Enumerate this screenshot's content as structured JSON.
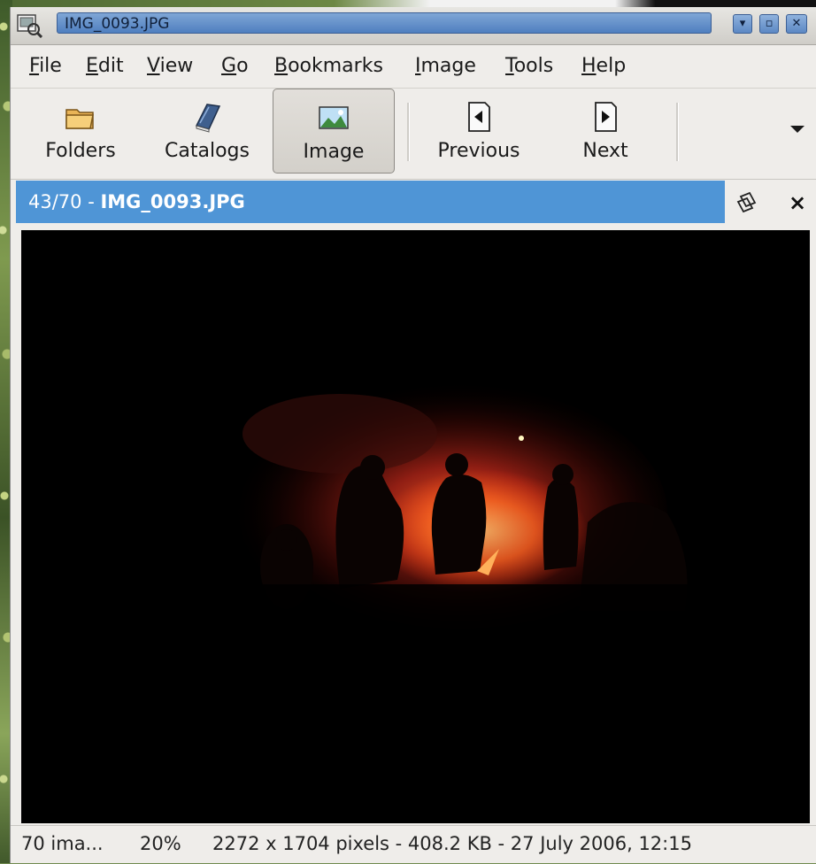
{
  "window": {
    "title": "IMG_0093.JPG",
    "controls": {
      "minimize_glyph": "▾",
      "maximize_glyph": "▫",
      "close_glyph": "✕"
    }
  },
  "menubar": {
    "items": [
      {
        "label": "File",
        "mnemonic": "F",
        "rest": "ile"
      },
      {
        "label": "Edit",
        "mnemonic": "E",
        "rest": "dit"
      },
      {
        "label": "View",
        "mnemonic": "V",
        "rest": "iew"
      },
      {
        "label": "Go",
        "mnemonic": "G",
        "rest": "o"
      },
      {
        "label": "Bookmarks",
        "mnemonic": "B",
        "rest": "ookmarks"
      },
      {
        "label": "Image",
        "mnemonic": "I",
        "rest": "mage"
      },
      {
        "label": "Tools",
        "mnemonic": "T",
        "rest": "ools"
      },
      {
        "label": "Help",
        "mnemonic": "H",
        "rest": "elp"
      }
    ]
  },
  "toolbar": {
    "folders_label": "Folders",
    "catalogs_label": "Catalogs",
    "image_label": "Image",
    "previous_label": "Previous",
    "next_label": "Next"
  },
  "image_header": {
    "position": "43/70 - ",
    "filename": "IMG_0093.JPG"
  },
  "statusbar": {
    "count": "70 ima...",
    "zoom": "20%",
    "info": "2272 x 1704 pixels - 408.2 KB - 27 July 2006, 12:15"
  },
  "colors": {
    "header_blue": "#4f95d6",
    "title_blue": "#5c88c4",
    "viewer_bg": "#000000",
    "fire": "#ff5a1a"
  }
}
